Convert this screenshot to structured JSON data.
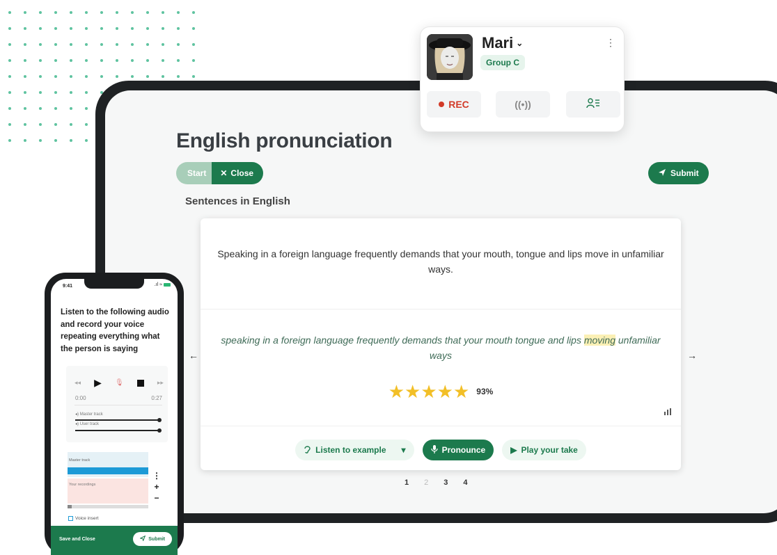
{
  "tablet": {
    "title": "English pronunciation",
    "start_label": "Start",
    "close_label": "Close",
    "submit_label": "Submit",
    "section_label": "Sentences in English",
    "sentence": "Speaking in a foreign language frequently demands that your mouth, tongue and lips move in unfamiliar ways.",
    "transcript_before": "speaking in a foreign language frequently demands that your mouth tongue and lips ",
    "transcript_highlight": "moving",
    "transcript_after": " unfamiliar ways",
    "rating_stars": 5,
    "score": "93%",
    "listen_label": "Listen to example",
    "pronounce_label": "Pronounce",
    "play_take_label": "Play your take",
    "pages": [
      "1",
      "2",
      "3",
      "4"
    ],
    "current_page": "2"
  },
  "profile": {
    "name": "Mari",
    "group": "Group C",
    "rec_label": "REC"
  },
  "phone": {
    "time": "9:41",
    "instructions": "Listen to the following audio and record your voice repeating everything what the person is saying",
    "time_start": "0:00",
    "time_end": "0:27",
    "master_track": "Master track",
    "user_track": "User track",
    "master_track_label": "Master track",
    "your_recordings": "Your recordings",
    "voice_insert": "Voice insert",
    "save_close": "Save and Close",
    "submit": "Submit"
  },
  "colors": {
    "brand_green": "#1c7a4d",
    "star": "#f2bf27",
    "rec_red": "#d23a28"
  }
}
